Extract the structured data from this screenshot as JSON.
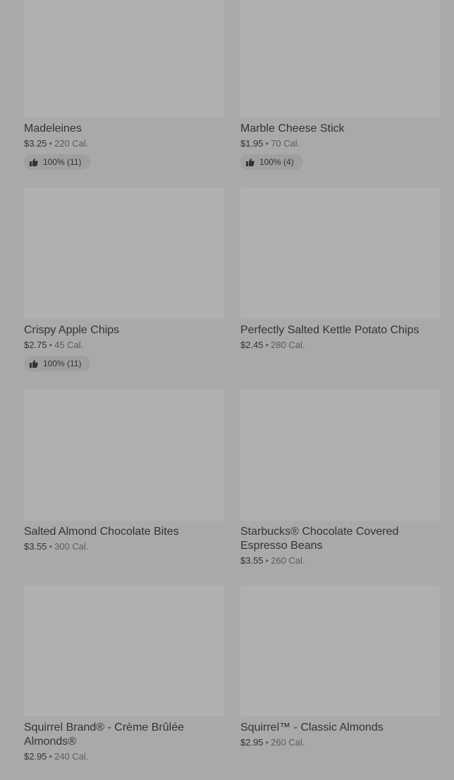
{
  "items": [
    {
      "name": "Madeleines",
      "price": "$3.25",
      "separator": "•",
      "calories": "220 Cal.",
      "rating": "100% (11)",
      "has_rating": true
    },
    {
      "name": "Marble Cheese Stick",
      "price": "$1.95",
      "separator": "•",
      "calories": "70 Cal.",
      "rating": "100% (4)",
      "has_rating": true
    },
    {
      "name": "Crispy Apple Chips",
      "price": "$2.75",
      "separator": "•",
      "calories": "45 Cal.",
      "rating": "100% (11)",
      "has_rating": true
    },
    {
      "name": "Perfectly Salted Kettle Potato Chips",
      "price": "$2.45",
      "separator": "•",
      "calories": "280 Cal.",
      "has_rating": false
    },
    {
      "name": "Salted Almond Chocolate Bites",
      "price": "$3.55",
      "separator": "•",
      "calories": "300 Cal.",
      "has_rating": false
    },
    {
      "name": "Starbucks® Chocolate Covered Espresso Beans",
      "price": "$3.55",
      "separator": "•",
      "calories": "260 Cal.",
      "has_rating": false
    },
    {
      "name": "Squirrel Brand® - Crème Brûlée Almonds®",
      "price": "$2.95",
      "separator": "•",
      "calories": "240 Cal.",
      "has_rating": false
    },
    {
      "name": "Squirrel™ - Classic Almonds",
      "price": "$2.95",
      "separator": "•",
      "calories": "260 Cal.",
      "has_rating": false
    }
  ],
  "colors": {
    "overlay_background": "#a9a9a9",
    "image_placeholder": "#b0b0b0",
    "text": "#333333"
  }
}
